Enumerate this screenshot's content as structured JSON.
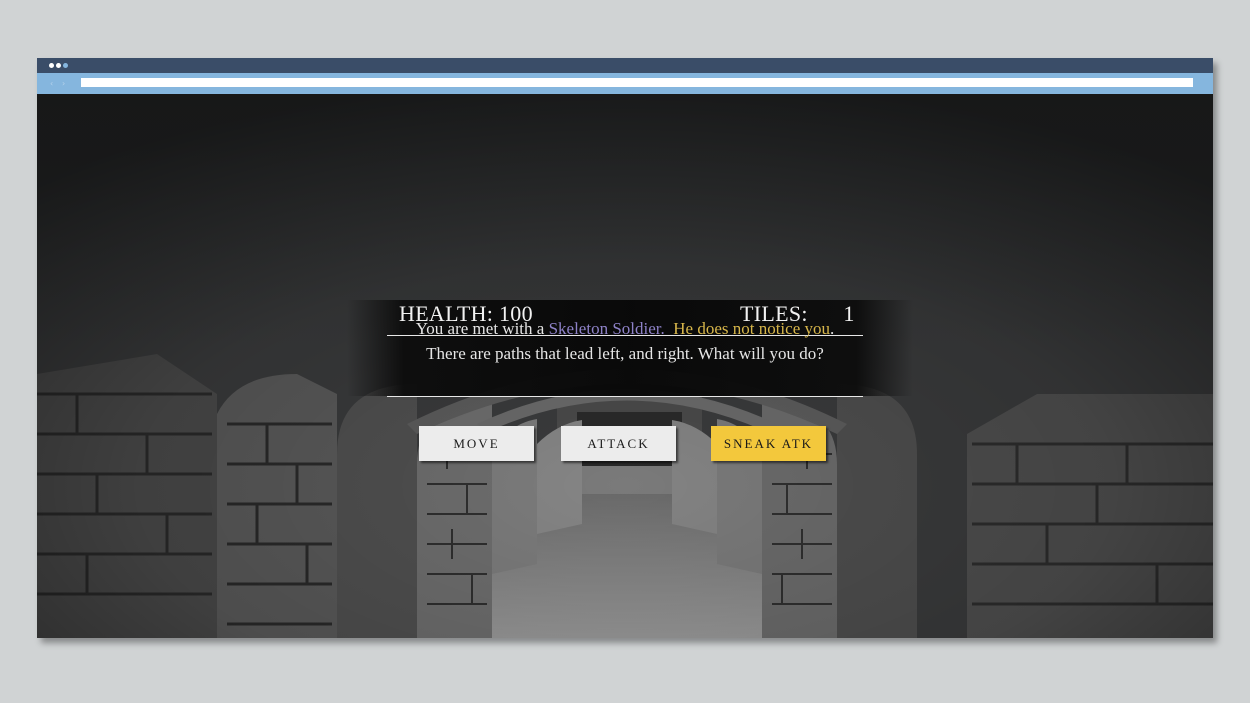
{
  "browser": {
    "window_dots": [
      "#ffffff",
      "#ffffff",
      "#85b6de"
    ],
    "back_icon": "chevron-left-icon",
    "forward_icon": "chevron-right-icon",
    "url": ""
  },
  "hud": {
    "health_label": "HEALTH:",
    "health_value": "100",
    "tiles_label": "TILES:",
    "tiles_value": "1"
  },
  "message": {
    "intro": "You are met with a ",
    "enemy": "Skeleton Soldier.",
    "gap": "  ",
    "status": "He does not notice you",
    "outro": ". There are paths that lead left, and right. What will you do?"
  },
  "actions": {
    "move_label": "MOVE",
    "attack_label": "ATTACK",
    "sneak_label": "SNEAK ATK"
  },
  "colors": {
    "enemy_name": "#8e82c8",
    "status_text": "#d7b64a",
    "highlight_button": "#f3c83c",
    "titlebar": "#3a4d68",
    "addressbar": "#85b6de"
  }
}
